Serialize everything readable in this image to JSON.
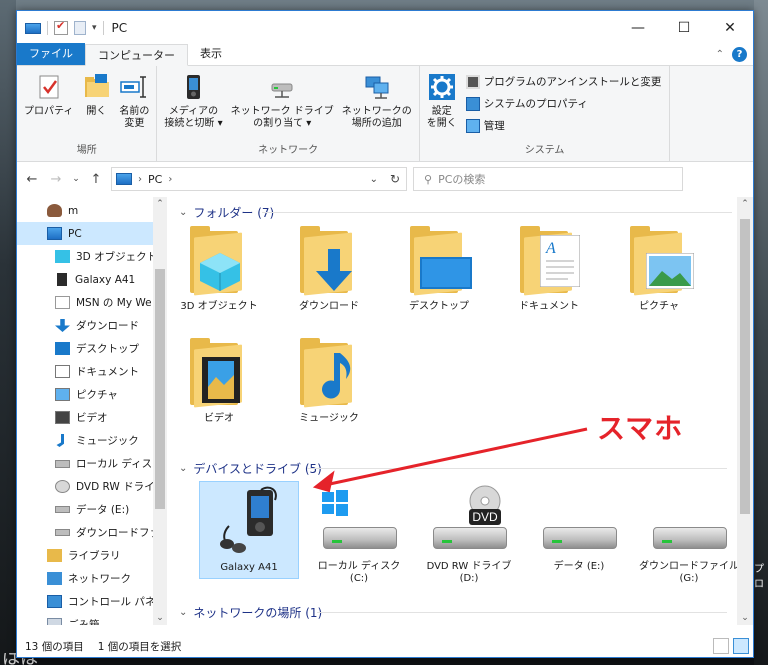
{
  "window": {
    "title": "PC",
    "controls": {
      "minimize": "—",
      "maximize": "☐",
      "close": "✕"
    }
  },
  "ribbon_tabs": [
    {
      "label": "ファイル"
    },
    {
      "label": "コンピューター"
    },
    {
      "label": "表示"
    }
  ],
  "ribbon": {
    "location": {
      "label": "場所",
      "buttons": [
        {
          "line1": "プロパティ",
          "line2": ""
        },
        {
          "line1": "開く",
          "line2": ""
        },
        {
          "line1": "名前の",
          "line2": "変更"
        }
      ]
    },
    "network": {
      "label": "ネットワーク",
      "buttons": [
        {
          "line1": "メディアの",
          "line2": "接続と切断 ▾"
        },
        {
          "line1": "ネットワーク ドライブ",
          "line2": "の割り当て ▾"
        },
        {
          "line1": "ネットワークの",
          "line2": "場所の追加"
        }
      ]
    },
    "system": {
      "label": "システム",
      "settings": {
        "line1": "設定",
        "line2": "を開く"
      },
      "small": [
        "プログラムのアンインストールと変更",
        "システムのプロパティ",
        "管理"
      ]
    }
  },
  "address": {
    "path": "PC",
    "search_placeholder": "PCの検索"
  },
  "nav": [
    {
      "label": "m",
      "icon": "user-icon"
    },
    {
      "label": "PC",
      "icon": "pc-icon",
      "selected": true
    },
    {
      "label": "3D オブジェクト",
      "icon": "3d-objects-icon"
    },
    {
      "label": "Galaxy A41",
      "icon": "phone-icon"
    },
    {
      "label": "MSN の My We",
      "icon": "document-icon"
    },
    {
      "label": "ダウンロード",
      "icon": "download-icon"
    },
    {
      "label": "デスクトップ",
      "icon": "desktop-icon"
    },
    {
      "label": "ドキュメント",
      "icon": "documents-icon"
    },
    {
      "label": "ピクチャ",
      "icon": "pictures-icon"
    },
    {
      "label": "ビデオ",
      "icon": "videos-icon"
    },
    {
      "label": "ミュージック",
      "icon": "music-icon"
    },
    {
      "label": "ローカル ディスク (",
      "icon": "local-disk-icon"
    },
    {
      "label": "DVD RW ドライブ",
      "icon": "dvd-drive-icon"
    },
    {
      "label": "データ (E:)",
      "icon": "drive-icon"
    },
    {
      "label": "ダウンロードファイ",
      "icon": "drive-icon"
    },
    {
      "label": "ライブラリ",
      "icon": "library-icon"
    },
    {
      "label": "ネットワーク",
      "icon": "network-icon"
    },
    {
      "label": "コントロール パネル",
      "icon": "control-panel-icon"
    },
    {
      "label": "ごみ箱",
      "icon": "recycle-bin-icon"
    }
  ],
  "sections": {
    "folders": {
      "header": "フォルダー (7)",
      "items": [
        "3D オブジェクト",
        "ダウンロード",
        "デスクトップ",
        "ドキュメント",
        "ピクチャ",
        "ビデオ",
        "ミュージック"
      ]
    },
    "devices": {
      "header": "デバイスとドライブ (5)",
      "items": [
        {
          "line1": "Galaxy A41",
          "line2": ""
        },
        {
          "line1": "ローカル ディスク",
          "line2": "(C:)"
        },
        {
          "line1": "DVD RW ドライブ",
          "line2": "(D:)"
        },
        {
          "line1": "データ (E:)",
          "line2": ""
        },
        {
          "line1": "ダウンロードファイル",
          "line2": "(G:)"
        }
      ],
      "dvd_badge": "DVD"
    },
    "network": {
      "header": "ネットワークの場所 (1)"
    }
  },
  "status": {
    "count": "13 個の項目",
    "selected": "1 個の項目を選択"
  },
  "annotation": {
    "text": "スマホ",
    "color": "#e5232a"
  },
  "colors": {
    "accent": "#1979ca",
    "selection": "#cce8ff",
    "folder": "#f7d376",
    "section_header": "#1e3287"
  },
  "desktop": {
    "right_text": "プロ",
    "bottom_text": "はは"
  }
}
